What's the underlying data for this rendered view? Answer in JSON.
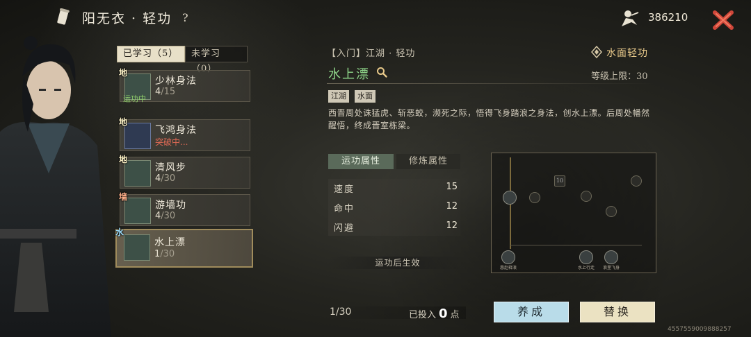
{
  "header": {
    "title": "阳无衣 · 轻功",
    "help_label": "?",
    "currency_value": "386210"
  },
  "tabs": [
    {
      "label": "已学习（5）"
    },
    {
      "label": "未学习（0）"
    }
  ],
  "skills": [
    {
      "name": "少林身法",
      "badge": "地",
      "level": "4",
      "max": "/15",
      "status": "",
      "running": "运功中"
    },
    {
      "name": "飞鸿身法",
      "badge": "地",
      "level": "",
      "max": "",
      "status": "突破中...",
      "running": ""
    },
    {
      "name": "清风步",
      "badge": "地",
      "level": "4",
      "max": "/30",
      "status": "",
      "running": ""
    },
    {
      "name": "游墙功",
      "badge": "墙",
      "level": "4",
      "max": "/30",
      "status": "",
      "running": ""
    },
    {
      "name": "水上漂",
      "badge": "水",
      "level": "1",
      "max": "/30",
      "status": "",
      "running": ""
    }
  ],
  "detail": {
    "breadcrumb": "【入门】江湖 · 轻功",
    "name": "水上漂",
    "category": "水面轻功",
    "level_cap": "等级上限：30",
    "tags": [
      "江湖",
      "水面"
    ],
    "description": "西晋周处诛猛虎、斩恶蛟，濒死之际，悟得飞身踏浪之身法，创水上漂。后周处幡然醒悟，终成晋室栋梁。",
    "attr_tabs": [
      "运功属性",
      "修炼属性"
    ],
    "stats": [
      {
        "key": "速度",
        "value": "15"
      },
      {
        "key": "命中",
        "value": "12"
      },
      {
        "key": "闪避",
        "value": "12"
      }
    ],
    "effect_note": "运功后生效"
  },
  "progress_map": {
    "node_labels": [
      "惠赴释浪",
      "水上行走",
      "浪里飞身"
    ],
    "node_tag": "10"
  },
  "footer": {
    "progress": "1/30",
    "invested_prefix": "已投入",
    "invested_value": "0",
    "invested_suffix": "点",
    "cultivate_label": "养成",
    "replace_label": "替换",
    "uid": "4557559009888257"
  },
  "colors": {
    "title_green": "#8fd68a",
    "category_gold": "#e8c98a",
    "breaking_red": "#e06a55",
    "running_green": "#8fd06a",
    "cultivate_blue": "#b9dce9",
    "replace_cream": "#ebe2c2"
  },
  "icons": [
    "scroll-icon",
    "ninja-currency-icon",
    "close-icon",
    "search-icon",
    "category-icon"
  ]
}
